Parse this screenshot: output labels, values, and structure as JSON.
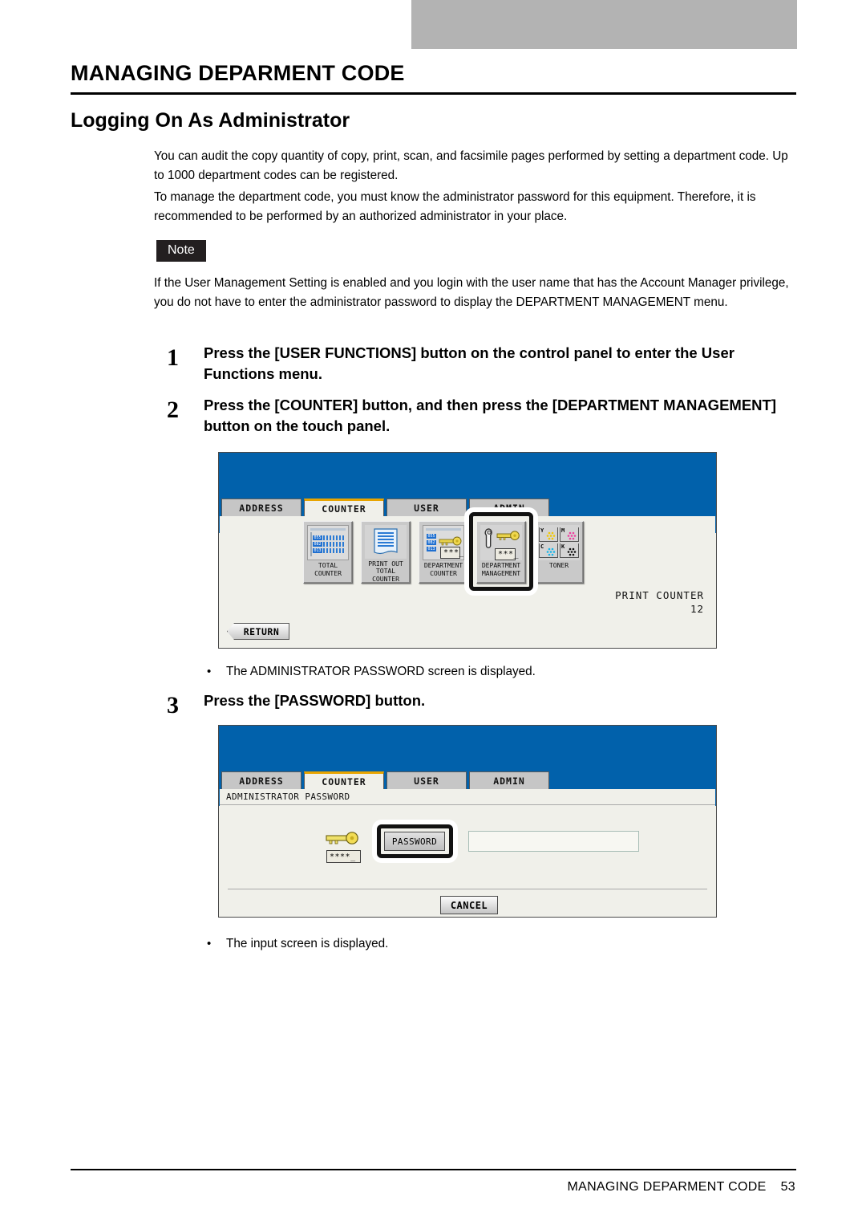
{
  "page": {
    "title": "MANAGING DEPARMENT CODE",
    "section_heading": "Logging On As Administrator",
    "paragraph_1": "You can audit the copy quantity of copy, print, scan, and facsimile pages performed by setting a department code.  Up to 1000 department codes can be registered.",
    "paragraph_2": "To manage the department code, you must know the administrator password for this equipment. Therefore, it is recommended to be performed by an authorized administrator in your place.",
    "note_label": "Note",
    "note_body": "If the User Management Setting is enabled and you login with the user name that has the Account Manager privilege, you do not have to enter the administrator password to display the DEPARTMENT MANAGEMENT menu."
  },
  "steps": [
    {
      "number": "1",
      "text": "Press the [USER FUNCTIONS] button on the control panel to enter the User Functions menu."
    },
    {
      "number": "2",
      "text": "Press the [COUNTER] button, and then press the [DEPARTMENT MANAGEMENT] button on the touch panel."
    },
    {
      "number": "3",
      "text": "Press the [PASSWORD] button."
    }
  ],
  "bullets": [
    {
      "marker": "•",
      "text": "The ADMINISTRATOR PASSWORD screen is displayed."
    },
    {
      "marker": "•",
      "text": "The input screen is displayed."
    }
  ],
  "counter_screen": {
    "tabs": [
      {
        "label": "ADDRESS",
        "active": false
      },
      {
        "label": "COUNTER",
        "active": true
      },
      {
        "label": "USER",
        "active": false
      },
      {
        "label": "ADMIN",
        "active": false
      }
    ],
    "buttons": [
      {
        "label": "TOTAL\nCOUNTER",
        "icon": "ledger-icon",
        "selected": false
      },
      {
        "label": "PRINT OUT\nTOTAL COUNTER",
        "icon": "printout-icon",
        "selected": false
      },
      {
        "label": "DEPARTMENT\nCOUNTER",
        "icon": "ledger-key-icon",
        "selected": false
      },
      {
        "label": "DEPARTMENT\nMANAGEMENT",
        "icon": "wrench-key-icon",
        "selected": true
      },
      {
        "label": "TONER",
        "icon": "toner-icon",
        "selected": false
      }
    ],
    "toner_cells": [
      {
        "letter": "Y",
        "color": "#f2c800"
      },
      {
        "letter": "M",
        "color": "#ee3fa0"
      },
      {
        "letter": "C",
        "color": "#17b5e8"
      },
      {
        "letter": "K",
        "color": "#111111"
      }
    ],
    "ledger_codes": [
      "055",
      "082",
      "013"
    ],
    "key_mask": "***_",
    "print_counter_label": "PRINT COUNTER",
    "print_counter_value": "12",
    "return_label": "RETURN"
  },
  "password_screen": {
    "tabs": [
      {
        "label": "ADDRESS",
        "active": false
      },
      {
        "label": "COUNTER",
        "active": true
      },
      {
        "label": "USER",
        "active": false
      },
      {
        "label": "ADMIN",
        "active": false
      }
    ],
    "caption": "ADMINISTRATOR PASSWORD",
    "key_mask": "****_",
    "password_button_label": "PASSWORD",
    "password_field_value": "",
    "cancel_label": "CANCEL"
  },
  "footer": {
    "text": "MANAGING DEPARMENT CODE",
    "page_number": "53"
  },
  "colors": {
    "panel_blue": "#0161ab",
    "tab_active_accent": "#e8a400",
    "gray_bar": "#b3b3b3",
    "note_bg": "#231f20"
  }
}
